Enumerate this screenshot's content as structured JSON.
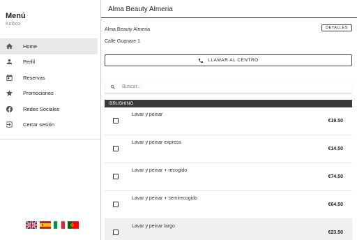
{
  "sidebar": {
    "title": "Menú",
    "subtitle": "Koibox",
    "items": [
      {
        "label": "Home",
        "icon": "home-icon",
        "active": true
      },
      {
        "label": "Perfil",
        "icon": "person-icon",
        "active": false
      },
      {
        "label": "Reservas",
        "icon": "calendar-icon",
        "active": false
      },
      {
        "label": "Promociones",
        "icon": "star-icon",
        "active": false
      },
      {
        "label": "Redes Sociales",
        "icon": "facebook-icon",
        "active": false
      },
      {
        "label": "Cerrar sesión",
        "icon": "logout-icon",
        "active": false
      }
    ],
    "languages": [
      {
        "code": "en",
        "icon": "uk-flag-icon"
      },
      {
        "code": "es",
        "icon": "spain-flag-icon"
      },
      {
        "code": "it",
        "icon": "italy-flag-icon"
      },
      {
        "code": "pt",
        "icon": "portugal-flag-icon"
      }
    ]
  },
  "header": {
    "title": "Alma Beauty Almeria"
  },
  "business": {
    "name": "Alma Beauty Almeria",
    "address": "Calle Guanare 1",
    "details_label": "DETALLES",
    "call_label": "LLAMAR AL CENTRO"
  },
  "search": {
    "placeholder": "Buscar..."
  },
  "category": {
    "name": "BRUSHING"
  },
  "services": [
    {
      "name": "Lavar y peinar",
      "price": "€19.50"
    },
    {
      "name": "Lavar y peinar express",
      "price": "€14.50"
    },
    {
      "name": "Lavar y peinar + recogido",
      "price": "€74.50"
    },
    {
      "name": "Lavar y peinar + semirecogido",
      "price": "€64.50"
    },
    {
      "name": "Lavar y peinar largo",
      "price": "€23.50"
    }
  ]
}
